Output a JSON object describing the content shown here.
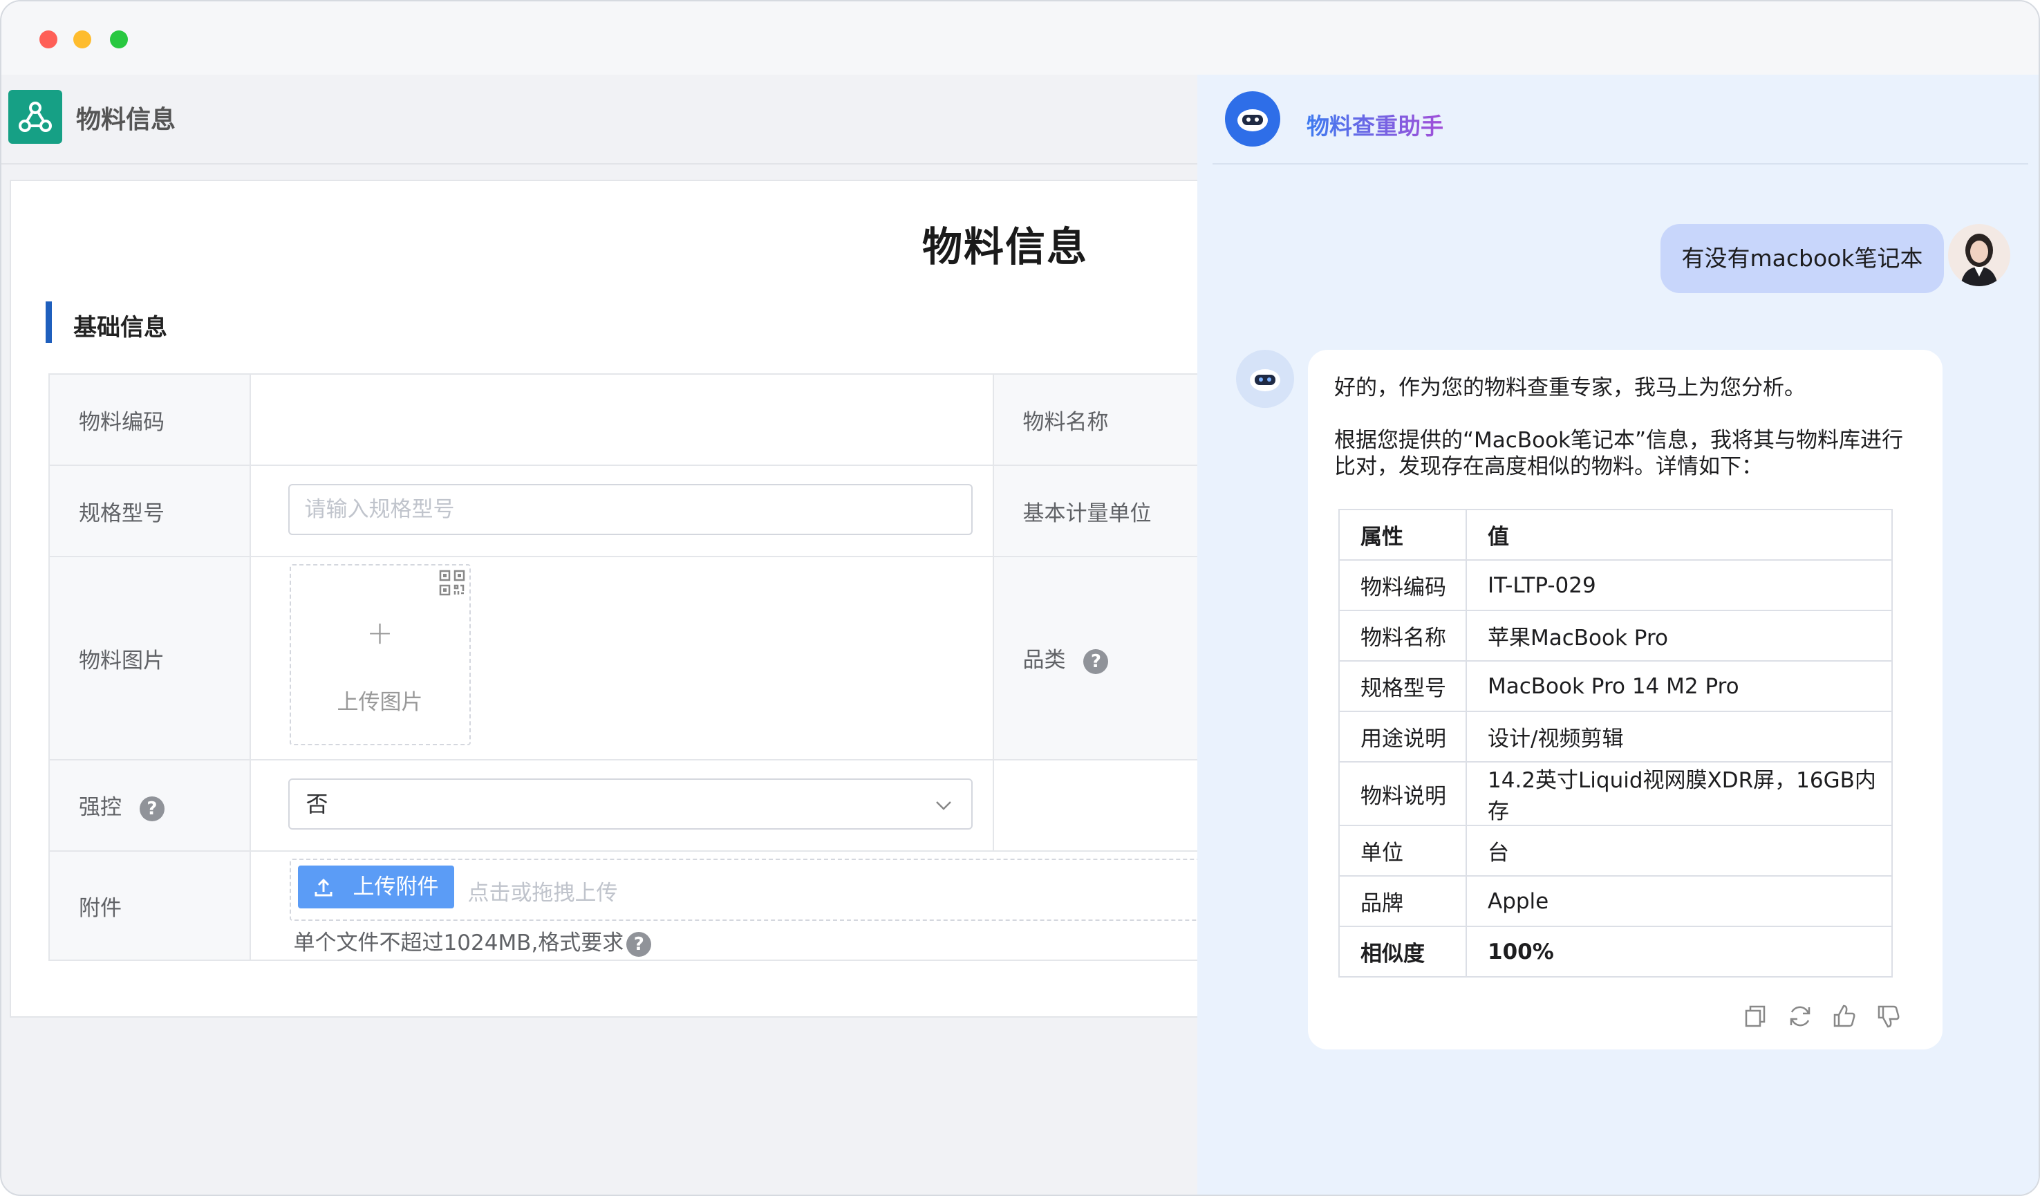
{
  "app": {
    "title": "物料信息"
  },
  "form": {
    "page_title": "物料信息",
    "section_title": "基础信息",
    "labels": {
      "code": "物料编码",
      "name": "物料名称",
      "spec": "规格型号",
      "unit": "基本计量单位",
      "image": "物料图片",
      "category": "品类",
      "strong_control": "强控",
      "attachment": "附件"
    },
    "spec_placeholder": "请输入规格型号",
    "upload_image_label": "上传图片",
    "strong_control_value": "否",
    "attachment": {
      "button_label": "上传附件",
      "hint": "点击或拖拽上传",
      "note": "单个文件不超过1024MB,格式要求"
    }
  },
  "chat": {
    "title": "物料查重助手",
    "user_message": "有没有macbook笔记本",
    "bot_intro": "好的，作为您的物料查重专家，我马上为您分析。",
    "bot_detail_line1": "根据您提供的“MacBook笔记本”信息，我将其与物料库进行",
    "bot_detail_line2": "比对，发现存在高度相似的物料。详情如下：",
    "table": {
      "header": [
        "属性",
        "值"
      ],
      "rows": [
        [
          "物料编码",
          "IT-LTP-029"
        ],
        [
          "物料名称",
          "苹果MacBook Pro"
        ],
        [
          "规格型号",
          "MacBook Pro 14 M2 Pro"
        ],
        [
          "用途说明",
          "设计/视频剪辑"
        ],
        [
          "物料说明",
          "14.2英寸Liquid视网膜XDR屏，16GB内存"
        ],
        [
          "单位",
          "台"
        ],
        [
          "品牌",
          "Apple"
        ],
        [
          "相似度",
          "100%"
        ]
      ]
    }
  }
}
